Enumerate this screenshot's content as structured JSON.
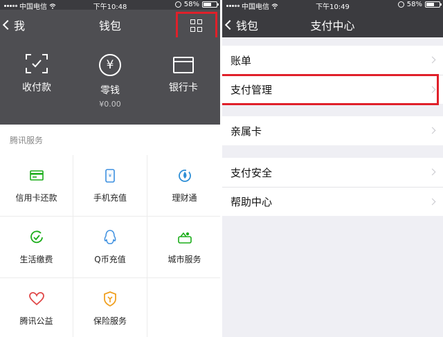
{
  "left": {
    "status": {
      "carrier": "中国电信",
      "time": "下午10:48",
      "battery": "58%"
    },
    "nav": {
      "back_label": "我",
      "title": "钱包"
    },
    "wallet": [
      {
        "label": "收付款",
        "sub": "",
        "icon": "scan-icon"
      },
      {
        "label": "零钱",
        "sub": "¥0.00",
        "icon": "yuan-coin-icon"
      },
      {
        "label": "银行卡",
        "sub": "",
        "icon": "bank-card-icon"
      }
    ],
    "services_title": "腾讯服务",
    "services": [
      {
        "label": "信用卡还款",
        "icon": "credit-card-icon",
        "color": "#1aad19"
      },
      {
        "label": "手机充值",
        "icon": "phone-topup-icon",
        "color": "#3b8fe0"
      },
      {
        "label": "理财通",
        "icon": "licaitong-icon",
        "color": "#2e8fd6"
      },
      {
        "label": "生活缴费",
        "icon": "utility-payment-icon",
        "color": "#1aad19"
      },
      {
        "label": "Q币充值",
        "icon": "qq-penguin-icon",
        "color": "#3b8fe0"
      },
      {
        "label": "城市服务",
        "icon": "city-service-icon",
        "color": "#1aad19"
      },
      {
        "label": "腾讯公益",
        "icon": "charity-heart-icon",
        "color": "#e04848"
      },
      {
        "label": "保险服务",
        "icon": "insurance-icon",
        "color": "#f0a020"
      }
    ]
  },
  "right": {
    "status": {
      "carrier": "中国电信",
      "time": "下午10:49",
      "battery": "58%"
    },
    "nav": {
      "back_label": "钱包",
      "title": "支付中心"
    },
    "sections": [
      [
        "账单",
        "支付管理"
      ],
      [
        "亲属卡"
      ],
      [
        "支付安全",
        "帮助中心"
      ]
    ]
  },
  "colors": {
    "highlight": "#e0202a",
    "header_dark": "#4e4e52",
    "status_bar": "#3b3b3f"
  }
}
